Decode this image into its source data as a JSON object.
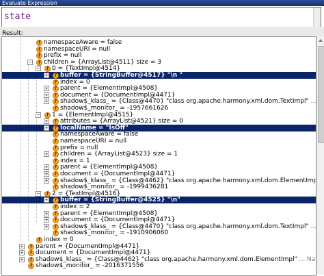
{
  "window": {
    "title": "Evaluate Expression"
  },
  "expression": {
    "value": "state"
  },
  "result": {
    "label": "Result:"
  },
  "tree": {
    "rows": [
      {
        "indent": 1,
        "toggle": "",
        "field": "namespaceAware",
        "text": " = false",
        "sel": false,
        "nav": ""
      },
      {
        "indent": 1,
        "toggle": "",
        "field": "namespaceURI",
        "text": " = null",
        "sel": false,
        "nav": ""
      },
      {
        "indent": 1,
        "toggle": "",
        "field": "prefix",
        "text": " = null",
        "sel": false,
        "nav": ""
      },
      {
        "indent": 1,
        "toggle": "−",
        "field": "children",
        "text": " = {ArrayList@4511}  size = 3",
        "sel": false,
        "nav": ""
      },
      {
        "indent": 2,
        "toggle": "−",
        "field": "0",
        "text": " = {TextImpl@4514}",
        "sel": false,
        "nav": ""
      },
      {
        "indent": 3,
        "toggle": "+",
        "field": "buffer",
        "text": " = {StringBuffer@4517} \"\\n   \"",
        "sel": true,
        "nav": ""
      },
      {
        "indent": 3,
        "toggle": "",
        "field": "index",
        "text": " = 0",
        "sel": false,
        "nav": ""
      },
      {
        "indent": 3,
        "toggle": "+",
        "field": "parent",
        "text": " = {ElementImpl@4508}",
        "sel": false,
        "nav": ""
      },
      {
        "indent": 3,
        "toggle": "+",
        "field": "document",
        "text": " = {DocumentImpl@4471}",
        "sel": false,
        "nav": ""
      },
      {
        "indent": 3,
        "toggle": "+",
        "field": "shadow$_klass_",
        "text": " = {Class@4470} \"class org.apache.harmony.xml.dom.TextImpl\"",
        "sel": false,
        "nav": " ... Navigate"
      },
      {
        "indent": 3,
        "toggle": "",
        "field": "shadow$_monitor_",
        "text": " = -1957661626",
        "sel": false,
        "nav": ""
      },
      {
        "indent": 2,
        "toggle": "−",
        "field": "1",
        "text": " = {ElementImpl@4515}",
        "sel": false,
        "nav": ""
      },
      {
        "indent": 3,
        "toggle": "+",
        "field": "attributes",
        "text": " = {ArrayList@4521}  size = 0",
        "sel": false,
        "nav": ""
      },
      {
        "indent": 3,
        "toggle": "+",
        "field": "localName",
        "text": " = \"IsOff\"",
        "sel": true,
        "nav": ""
      },
      {
        "indent": 3,
        "toggle": "",
        "field": "namespaceAware",
        "text": " = false",
        "sel": false,
        "nav": ""
      },
      {
        "indent": 3,
        "toggle": "",
        "field": "namespaceURI",
        "text": " = null",
        "sel": false,
        "nav": ""
      },
      {
        "indent": 3,
        "toggle": "",
        "field": "prefix",
        "text": " = null",
        "sel": false,
        "nav": ""
      },
      {
        "indent": 3,
        "toggle": "+",
        "field": "children",
        "text": " = {ArrayList@4523}  size = 1",
        "sel": false,
        "nav": ""
      },
      {
        "indent": 3,
        "toggle": "",
        "field": "index",
        "text": " = 1",
        "sel": false,
        "nav": ""
      },
      {
        "indent": 3,
        "toggle": "+",
        "field": "parent",
        "text": " = {ElementImpl@4508}",
        "sel": false,
        "nav": ""
      },
      {
        "indent": 3,
        "toggle": "+",
        "field": "document",
        "text": " = {DocumentImpl@4471}",
        "sel": false,
        "nav": ""
      },
      {
        "indent": 3,
        "toggle": "+",
        "field": "shadow$_klass_",
        "text": " = {Class@4462} \"class org.apache.harmony.xml.dom.ElementImpl\"",
        "sel": false,
        "nav": " ... Navigate"
      },
      {
        "indent": 3,
        "toggle": "",
        "field": "shadow$_monitor_",
        "text": " = -1999436281",
        "sel": false,
        "nav": ""
      },
      {
        "indent": 2,
        "toggle": "−",
        "field": "2",
        "text": " = {TextImpl@4516}",
        "sel": false,
        "nav": ""
      },
      {
        "indent": 3,
        "toggle": "+",
        "field": "buffer",
        "text": " = {StringBuffer@4525} \"\\n\"",
        "sel": true,
        "nav": ""
      },
      {
        "indent": 3,
        "toggle": "",
        "field": "index",
        "text": " = 2",
        "sel": false,
        "nav": ""
      },
      {
        "indent": 3,
        "toggle": "+",
        "field": "parent",
        "text": " = {ElementImpl@4508}",
        "sel": false,
        "nav": ""
      },
      {
        "indent": 3,
        "toggle": "+",
        "field": "document",
        "text": " = {DocumentImpl@4471}",
        "sel": false,
        "nav": ""
      },
      {
        "indent": 3,
        "toggle": "+",
        "field": "shadow$_klass_",
        "text": " = {Class@4470} \"class org.apache.harmony.xml.dom.TextImpl\"",
        "sel": false,
        "nav": " ... Navigate"
      },
      {
        "indent": 3,
        "toggle": "",
        "field": "shadow$_monitor_",
        "text": " = -1910906060",
        "sel": false,
        "nav": ""
      },
      {
        "indent": 1,
        "toggle": "",
        "field": "index",
        "text": " = 0",
        "sel": false,
        "nav": ""
      },
      {
        "indent": 0,
        "toggle": "+",
        "field": "parent",
        "text": " = {DocumentImpl@4471}",
        "sel": false,
        "nav": ""
      },
      {
        "indent": 0,
        "toggle": "+",
        "field": "document",
        "text": " = {DocumentImpl@4471}",
        "sel": false,
        "nav": ""
      },
      {
        "indent": 0,
        "toggle": "+",
        "field": "shadow$_klass_",
        "text": " = {Class@4462} \"class org.apache.harmony.xml.dom.ElementImpl\"",
        "sel": false,
        "nav": " ... Navigate"
      },
      {
        "indent": 0,
        "toggle": "",
        "field": "shadow$_monitor_",
        "text": " = -2016371556",
        "sel": false,
        "nav": ""
      }
    ]
  },
  "icons": {
    "field": "field-icon",
    "expand": "expand-toggle-icon",
    "collapse": "collapse-toggle-icon"
  },
  "colors": {
    "selection": "#0a246a",
    "title_bar": "#17306c",
    "field_icon": "#f5a531"
  }
}
